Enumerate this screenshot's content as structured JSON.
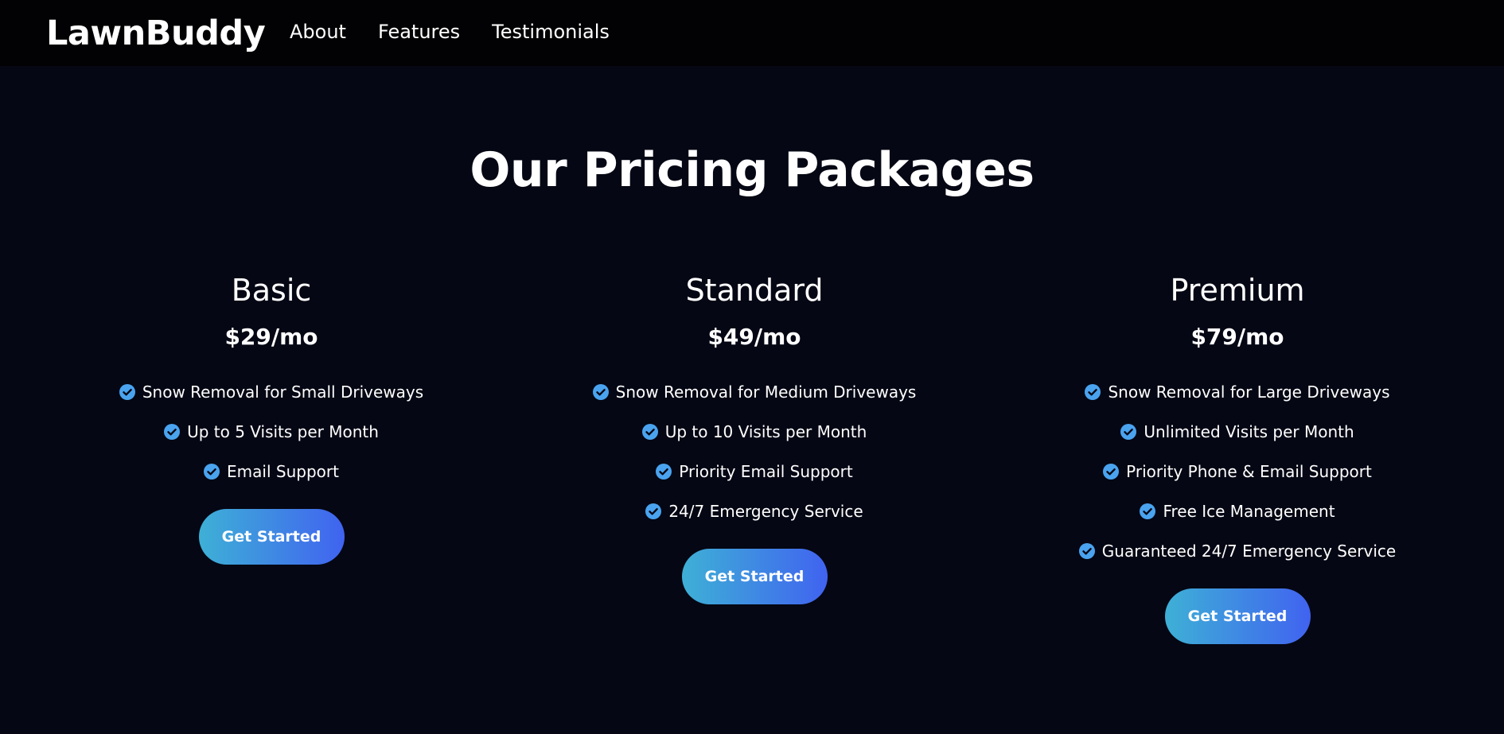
{
  "brand": {
    "name": "LawnBuddy"
  },
  "nav": {
    "links": [
      "About",
      "Features",
      "Testimonials"
    ]
  },
  "pricing": {
    "title": "Our Pricing Packages",
    "plans": [
      {
        "name": "Basic",
        "price": "$29/mo",
        "features": [
          "Snow Removal for Small Driveways",
          "Up to 5 Visits per Month",
          "Email Support"
        ],
        "cta": "Get Started"
      },
      {
        "name": "Standard",
        "price": "$49/mo",
        "features": [
          "Snow Removal for Medium Driveways",
          "Up to 10 Visits per Month",
          "Priority Email Support",
          "24/7 Emergency Service"
        ],
        "cta": "Get Started"
      },
      {
        "name": "Premium",
        "price": "$79/mo",
        "features": [
          "Snow Removal for Large Driveways",
          "Unlimited Visits per Month",
          "Priority Phone & Email Support",
          "Free Ice Management",
          "Guaranteed 24/7 Emergency Service"
        ],
        "cta": "Get Started"
      }
    ]
  },
  "icons": {
    "feature_check": "check-circle-icon"
  },
  "colors": {
    "background": "#050714",
    "navbar": "#020204",
    "accent_start": "#3eb0d6",
    "accent_end": "#4063f0",
    "check": "#4aa3ef"
  }
}
